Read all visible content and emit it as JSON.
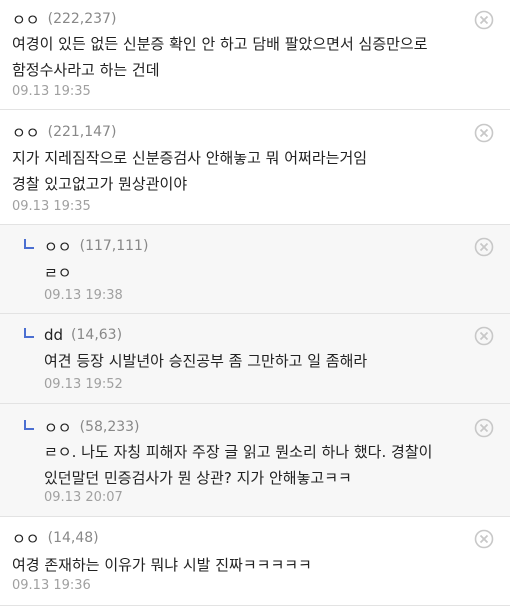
{
  "comments": [
    {
      "author": "ㅇㅇ",
      "score": "(222,237)",
      "lines": [
        "여경이 있든 없든 신분증 확인 안 하고 담배 팔았으면서 심증만으로",
        "함정수사라고 하는 건데"
      ],
      "time": "09.13 19:35",
      "reply": false
    },
    {
      "author": "ㅇㅇ",
      "score": "(221,147)",
      "lines": [
        "지가 지레짐작으로 신분증검사 안해놓고 뭐 어쩌라는거임",
        "경찰 있고없고가 뭔상관이야"
      ],
      "time": "09.13 19:35",
      "reply": false
    },
    {
      "author": "ㅇㅇ",
      "score": "(117,111)",
      "lines": [
        "ㄹㅇ"
      ],
      "time": "09.13 19:38",
      "reply": true
    },
    {
      "author": "dd",
      "score": "(14,63)",
      "lines": [
        "여견 등장 시발년아 승진공부 좀 그만하고 일 좀해라"
      ],
      "time": "09.13 19:52",
      "reply": true
    },
    {
      "author": "ㅇㅇ",
      "score": "(58,233)",
      "lines": [
        "ㄹㅇ. 나도 자칭 피해자 주장 글 읽고 뭔소리 하나 했다. 경찰이",
        "있던말던 민증검사가 뭔 상관? 지가 안해놓고ㅋㅋ"
      ],
      "time": "09.13 20:07",
      "reply": true
    },
    {
      "author": "ㅇㅇ",
      "score": "(14,48)",
      "lines": [
        "여경 존재하는 이유가 뭐냐 시발 진짜ㅋㅋㅋㅋㅋ"
      ],
      "time": "09.13 19:36",
      "reply": false
    }
  ],
  "icons": {
    "delete": "close-circle-icon",
    "reply": "reply-arrow-icon"
  },
  "colors": {
    "reply_arrow": "#4b6fd1",
    "reply_background": "#f7f7f7",
    "meta": "#a0a0a0"
  }
}
